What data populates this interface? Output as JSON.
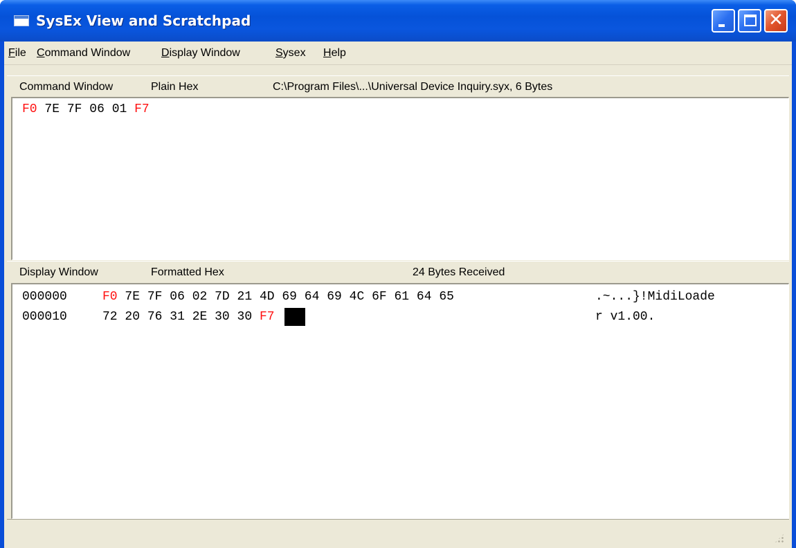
{
  "window": {
    "title": "SysEx View and Scratchpad",
    "colors": {
      "title_bar": "#0552d8",
      "close": "#e1542b",
      "accent_red": "#ff1010"
    }
  },
  "menu": {
    "items": [
      "File",
      "Command Window",
      "Display Window",
      "Sysex",
      "Help"
    ],
    "mnemonics": [
      "F",
      "C",
      "D",
      "S",
      "H"
    ]
  },
  "command_pane": {
    "label": "Command Window",
    "mode": "Plain Hex",
    "file_info": "C:\\Program Files\\...\\Universal Device Inquiry.syx,  6 Bytes",
    "bytes": [
      {
        "v": "F0",
        "marker": true
      },
      {
        "v": "7E",
        "marker": false
      },
      {
        "v": "7F",
        "marker": false
      },
      {
        "v": "06",
        "marker": false
      },
      {
        "v": "01",
        "marker": false
      },
      {
        "v": "F7",
        "marker": true
      }
    ]
  },
  "display_pane": {
    "label": "Display Window",
    "mode": "Formatted Hex",
    "status": "24  Bytes Received",
    "rows": [
      {
        "offset": "000000",
        "bytes": [
          {
            "v": "F0",
            "marker": true
          },
          {
            "v": "7E",
            "marker": false
          },
          {
            "v": "7F",
            "marker": false
          },
          {
            "v": "06",
            "marker": false
          },
          {
            "v": "02",
            "marker": false
          },
          {
            "v": "7D",
            "marker": false
          },
          {
            "v": "21",
            "marker": false
          },
          {
            "v": "4D",
            "marker": false
          },
          {
            "v": "69",
            "marker": false
          },
          {
            "v": "64",
            "marker": false
          },
          {
            "v": "69",
            "marker": false
          },
          {
            "v": "4C",
            "marker": false
          },
          {
            "v": "6F",
            "marker": false
          },
          {
            "v": "61",
            "marker": false
          },
          {
            "v": "64",
            "marker": false
          },
          {
            "v": "65",
            "marker": false
          }
        ],
        "ascii": ".~...}!MidiLoade"
      },
      {
        "offset": "000010",
        "bytes": [
          {
            "v": "72",
            "marker": false
          },
          {
            "v": "20",
            "marker": false
          },
          {
            "v": "76",
            "marker": false
          },
          {
            "v": "31",
            "marker": false
          },
          {
            "v": "2E",
            "marker": false
          },
          {
            "v": "30",
            "marker": false
          },
          {
            "v": "30",
            "marker": false
          },
          {
            "v": "F7",
            "marker": true
          }
        ],
        "ascii": "r v1.00."
      }
    ]
  },
  "icons": {
    "app": "app-window-icon",
    "minimize": "minimize-icon",
    "maximize": "maximize-icon",
    "close": "close-icon",
    "grip": "resize-grip-icon"
  }
}
